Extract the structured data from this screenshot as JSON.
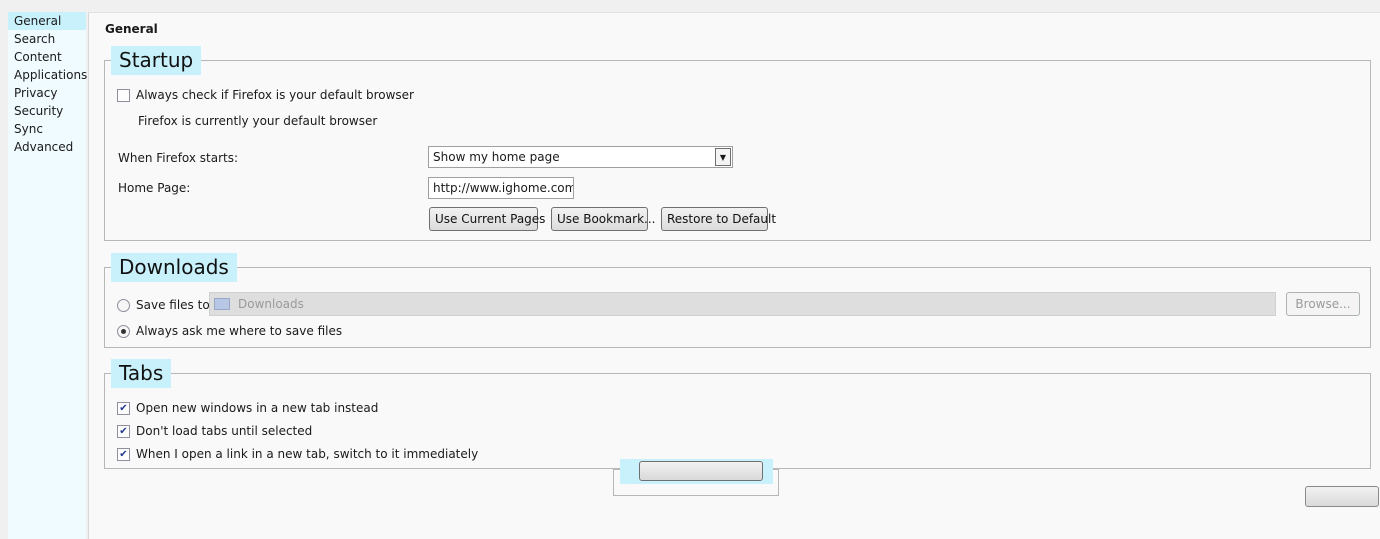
{
  "sidebar": {
    "items": [
      {
        "label": "General",
        "selected": true
      },
      {
        "label": "Search"
      },
      {
        "label": "Content"
      },
      {
        "label": "Applications"
      },
      {
        "label": "Privacy"
      },
      {
        "label": "Security"
      },
      {
        "label": "Sync"
      },
      {
        "label": "Advanced"
      }
    ]
  },
  "page": {
    "title": "General"
  },
  "startup": {
    "caption": "Startup",
    "default_check": {
      "label": "Always check if Firefox is your default browser",
      "checked": false
    },
    "default_status": "Firefox is currently your default browser",
    "when_starts": {
      "label": "When Firefox starts:",
      "value": "Show my home page"
    },
    "home_page": {
      "label": "Home Page:",
      "value": "http://www.ighome.com/"
    },
    "buttons": {
      "use_current": "Use Current Pages",
      "use_bookmark": "Use Bookmark...",
      "restore_default": "Restore to Default"
    }
  },
  "downloads": {
    "caption": "Downloads",
    "save_to": {
      "label": "Save files to",
      "selected": false
    },
    "path": "Downloads",
    "browse": "Browse...",
    "always_ask": {
      "label": "Always ask me where to save files",
      "selected": true
    }
  },
  "tabs": {
    "caption": "Tabs",
    "options": [
      {
        "label": "Open new windows in a new tab instead",
        "checked": true
      },
      {
        "label": "Don't load tabs until selected",
        "checked": true
      },
      {
        "label": "When I open a link in a new tab, switch to it immediately",
        "checked": true
      }
    ]
  },
  "colors": {
    "highlight": "#c9f1fc",
    "sidebar_bg": "#f0fbff",
    "checkmark": "#21398e"
  },
  "icons": {
    "check": "✔",
    "dropdown": "▼",
    "folder": "folder-icon"
  }
}
